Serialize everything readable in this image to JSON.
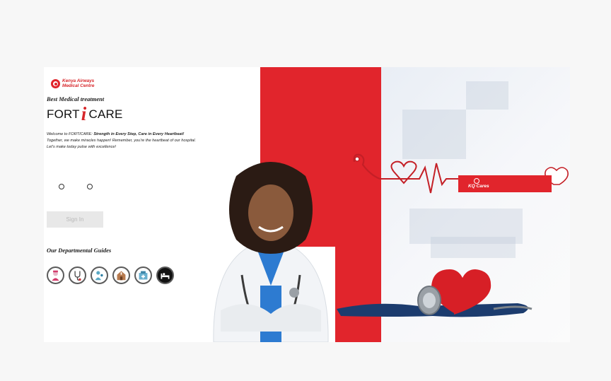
{
  "brand": {
    "line1": "Kenya Airways",
    "line2": "Medical Centre",
    "logo_small": "Kenya"
  },
  "tagline": "Best Medical treatment",
  "product": {
    "part1": "FORT",
    "part2": "i",
    "part3": "CARE"
  },
  "welcome": {
    "lead": "Welcome to FORTICARE: ",
    "bold": "Strength in Every Step, Care in Every Heartbeat!",
    "line2": "Together, we make miracles happen! Remember, you're the heartbeat of our hospital.",
    "line3": "Let's make today pulse with excellence!"
  },
  "radios": [
    {
      "name": "option-1"
    },
    {
      "name": "option-2"
    }
  ],
  "signin": {
    "label": "Sign In"
  },
  "guides": {
    "title": "Our Departmental Guides",
    "items": [
      {
        "icon": "nurse-icon"
      },
      {
        "icon": "stethoscope-icon"
      },
      {
        "icon": "caregiver-icon"
      },
      {
        "icon": "hospital-building-icon"
      },
      {
        "icon": "pharmacy-icon"
      },
      {
        "icon": "bed-icon"
      }
    ]
  },
  "banner": {
    "label": "KQ Cares"
  },
  "colors": {
    "brand_red": "#e1252c",
    "text_dark": "#1a1a1a",
    "button_disabled": "#e8e8e8"
  }
}
